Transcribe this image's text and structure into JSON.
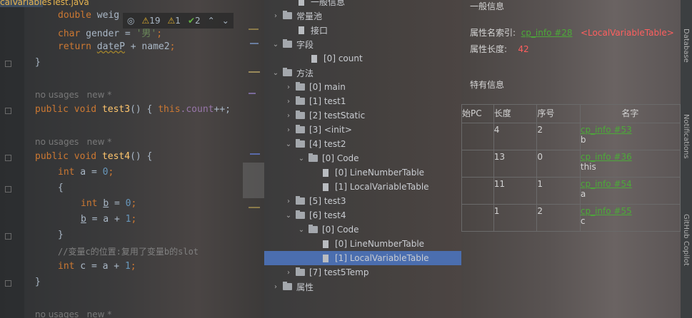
{
  "editor": {
    "tab_title": "calVariablesTest.java",
    "inspections": {
      "warnings": "19",
      "weak_warnings": "1",
      "ok": "2"
    },
    "lines": {
      "l1_type": "double",
      "l1_rest": " weig",
      "l2_type": "char",
      "l2_var": " gender = ",
      "l2_str": "'男'",
      "l2_end": ";",
      "l3_kw": "return",
      "l3_var": "dateP",
      "l3_op": " + ",
      "l3_var2": "name2",
      "l3_end": ";",
      "l4": "}",
      "hint1": "no usages   new *",
      "l5_kw1": "public",
      "l5_kw2": "void",
      "l5_fn": "test3",
      "l5_mid": "() { ",
      "l5_this": "this",
      "l5_field": ".count",
      "l5_end": "++; ",
      "hint2": "no usages   new *",
      "l6_kw1": "public",
      "l6_kw2": "void",
      "l6_fn": "test4",
      "l6_end": "() {",
      "l7_kw": "int",
      "l7_var": " a = ",
      "l7_num": "0",
      "l7_end": ";",
      "l8": "{",
      "l9_kw": "int",
      "l9_var": "b",
      "l9_mid": " = ",
      "l9_num": "0",
      "l9_end": ";",
      "l10_var": "b",
      "l10_mid": " = a + ",
      "l10_num": "1",
      "l10_end": ";",
      "l11": "}",
      "l12_cmt": "//变量c的位置:复用了变量b的slot",
      "l13_kw": "int",
      "l13_var": " c = a + ",
      "l13_num": "1",
      "l13_end": ";",
      "l14": "}",
      "hint3": "no usages   new *"
    }
  },
  "tree": {
    "items": [
      {
        "label": "一般信息",
        "arrow": "",
        "icon": "file"
      },
      {
        "label": "常量池",
        "arrow": "›",
        "icon": "folder"
      },
      {
        "label": "接口",
        "arrow": "",
        "icon": "file"
      },
      {
        "label": "字段",
        "arrow": "⌄",
        "icon": "folder"
      },
      {
        "label": "[0] count",
        "arrow": "",
        "icon": "file"
      },
      {
        "label": "方法",
        "arrow": "⌄",
        "icon": "folder"
      },
      {
        "label": "[0] main",
        "arrow": "›",
        "icon": "folder"
      },
      {
        "label": "[1] test1",
        "arrow": "›",
        "icon": "folder"
      },
      {
        "label": "[2] testStatic",
        "arrow": "›",
        "icon": "folder"
      },
      {
        "label": "[3] <init>",
        "arrow": "›",
        "icon": "folder"
      },
      {
        "label": "[4] test2",
        "arrow": "⌄",
        "icon": "folder"
      },
      {
        "label": "[0] Code",
        "arrow": "⌄",
        "icon": "folder"
      },
      {
        "label": "[0] LineNumberTable",
        "arrow": "",
        "icon": "file"
      },
      {
        "label": "[1] LocalVariableTable",
        "arrow": "",
        "icon": "file"
      },
      {
        "label": "[5] test3",
        "arrow": "›",
        "icon": "folder"
      },
      {
        "label": "[6] test4",
        "arrow": "⌄",
        "icon": "folder"
      },
      {
        "label": "[0] Code",
        "arrow": "⌄",
        "icon": "folder"
      },
      {
        "label": "[0] LineNumberTable",
        "arrow": "",
        "icon": "file"
      },
      {
        "label": "[1] LocalVariableTable",
        "arrow": "",
        "icon": "file"
      },
      {
        "label": "[7] test5Temp",
        "arrow": "›",
        "icon": "folder"
      },
      {
        "label": "属性",
        "arrow": "›",
        "icon": "folder"
      }
    ]
  },
  "panel": {
    "general_title": "一般信息",
    "name_index_label": "属性名索引:",
    "name_index_link": "cp_info #28",
    "name_index_value": "<LocalVariableTable>",
    "length_label": "属性长度:",
    "length_value": "42",
    "specific_title": "特有信息",
    "columns": [
      "始PC",
      "长度",
      "序号",
      "名字"
    ],
    "rows": [
      {
        "len": "4",
        "idx": "2",
        "link": "cp_info #53",
        "name": "b"
      },
      {
        "len": "13",
        "idx": "0",
        "link": "cp_info #36",
        "name": "this"
      },
      {
        "len": "11",
        "idx": "1",
        "link": "cp_info #54",
        "name": "a"
      },
      {
        "len": "1",
        "idx": "2",
        "link": "cp_info #55",
        "name": "c"
      }
    ]
  },
  "right_sidebar": {
    "label1": "Database",
    "label2": "Notifications",
    "label3": "GitHub Copilot"
  },
  "colors": {
    "selection": "#4b6eaf",
    "link": "#4caa38",
    "red": "#ff5f5f",
    "keyword": "#cc7832"
  }
}
